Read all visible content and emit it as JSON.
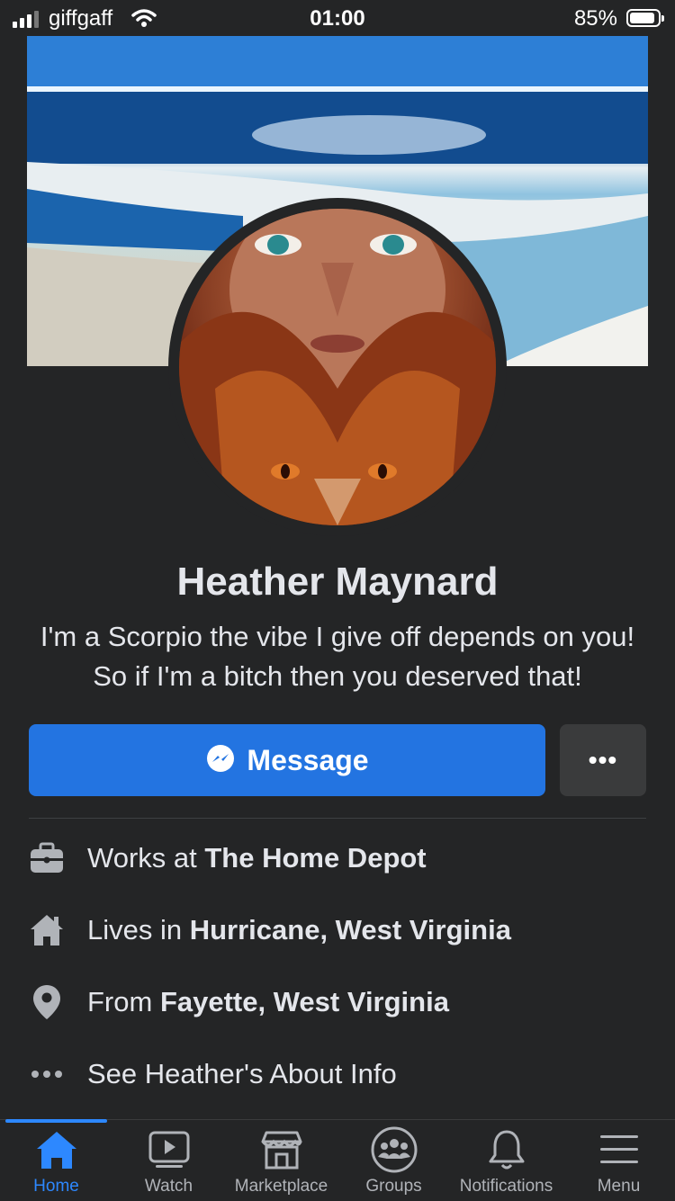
{
  "status": {
    "carrier": "giffgaff",
    "time": "01:00",
    "battery": "85%"
  },
  "profile": {
    "name": "Heather Maynard",
    "bio": "I'm a Scorpio the vibe I give off depends on you! So if I'm a bitch then you deserved that!",
    "message_label": "Message",
    "more_label": "•••"
  },
  "info": {
    "work_prefix": "Works at ",
    "work_value": "The Home Depot",
    "lives_prefix": "Lives in ",
    "lives_value": "Hurricane, West Virginia",
    "from_prefix": "From ",
    "from_value": "Fayette, West Virginia",
    "about_label": "See Heather's About Info"
  },
  "tabs": [
    {
      "label": "Home",
      "icon": "home-icon"
    },
    {
      "label": "Watch",
      "icon": "watch-icon"
    },
    {
      "label": "Marketplace",
      "icon": "marketplace-icon"
    },
    {
      "label": "Groups",
      "icon": "groups-icon"
    },
    {
      "label": "Notifications",
      "icon": "bell-icon"
    },
    {
      "label": "Menu",
      "icon": "menu-icon"
    }
  ],
  "colors": {
    "background": "#242526",
    "accent": "#2374e1",
    "active_tab": "#2d88ff",
    "secondary_button": "#3a3b3c"
  }
}
